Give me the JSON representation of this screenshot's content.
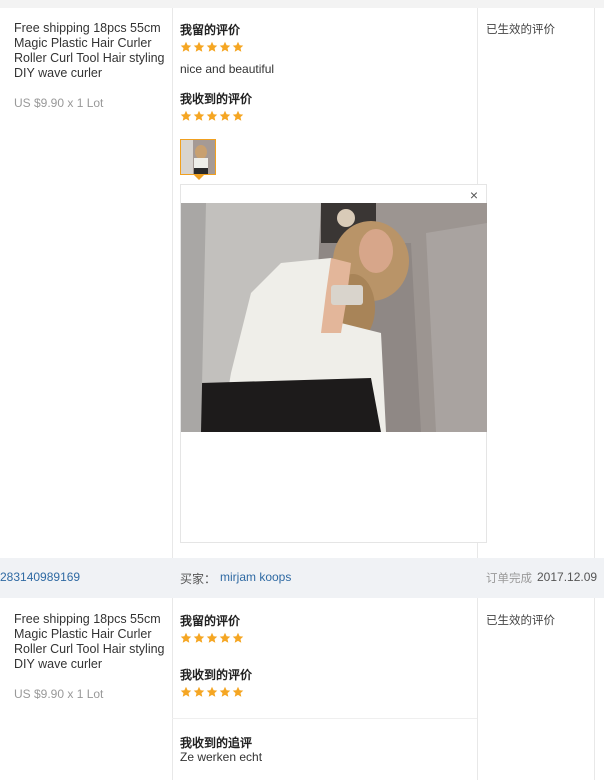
{
  "review_1": {
    "product_title": "Free shipping 18pcs 55cm Magic Plastic Hair Curler Roller Curl Tool Hair styling DIY wave curler",
    "price": "US $9.90 x 1 Lot",
    "my_review_heading": "我留的评价",
    "my_rating": 5,
    "my_review_text": "nice and beautiful",
    "received_heading": "我收到的评价",
    "received_rating": 5,
    "status": "已生效的评价",
    "close_glyph": "×"
  },
  "order": {
    "order_id": "283140989169",
    "buyer_label": "买家：",
    "buyer_name": "mirjam koops",
    "completed_label": "订单完成",
    "completed_date": "2017.12.09"
  },
  "review_2": {
    "product_title": "Free shipping 18pcs 55cm Magic Plastic Hair Curler Roller Curl Tool Hair styling DIY wave curler",
    "price": "US $9.90 x 1 Lot",
    "my_review_heading": "我留的评价",
    "my_rating": 5,
    "received_heading": "我收到的评价",
    "received_rating": 5,
    "followup_heading": "我收到的追评",
    "followup_text": "Ze werken echt",
    "status": "已生效的评价"
  },
  "colors": {
    "star": "#f5a623",
    "link": "#2f6aa3",
    "accent": "#f0a020"
  }
}
